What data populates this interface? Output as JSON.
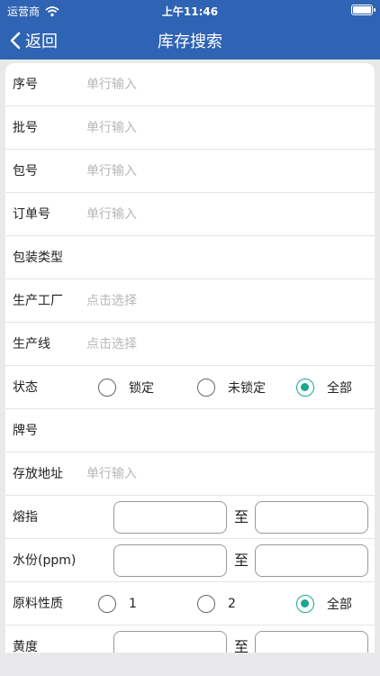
{
  "status_bar": {
    "carrier": "运营商",
    "time": "上午11:46"
  },
  "nav": {
    "back_label": "返回",
    "title": "库存搜索"
  },
  "form": {
    "serial": {
      "label": "序号",
      "placeholder": "单行输入"
    },
    "batch": {
      "label": "批号",
      "placeholder": "单行输入"
    },
    "package": {
      "label": "包号",
      "placeholder": "单行输入"
    },
    "order": {
      "label": "订单号",
      "placeholder": "单行输入"
    },
    "package_type": {
      "label": "包装类型"
    },
    "factory": {
      "label": "生产工厂",
      "placeholder": "点击选择"
    },
    "line": {
      "label": "生产线",
      "placeholder": "点击选择"
    },
    "state": {
      "label": "状态",
      "options": [
        "锁定",
        "未锁定",
        "全部"
      ],
      "selected": "全部"
    },
    "brand": {
      "label": "牌号"
    },
    "location": {
      "label": "存放地址",
      "placeholder": "单行输入"
    },
    "melt_index": {
      "label": "熔指",
      "to": "至"
    },
    "moisture": {
      "label": "水份(ppm)",
      "to": "至"
    },
    "material": {
      "label": "原料性质",
      "options": [
        "1",
        "2",
        "全部"
      ],
      "selected": "全部"
    },
    "yellowness": {
      "label": "黄度",
      "to": "至"
    }
  }
}
